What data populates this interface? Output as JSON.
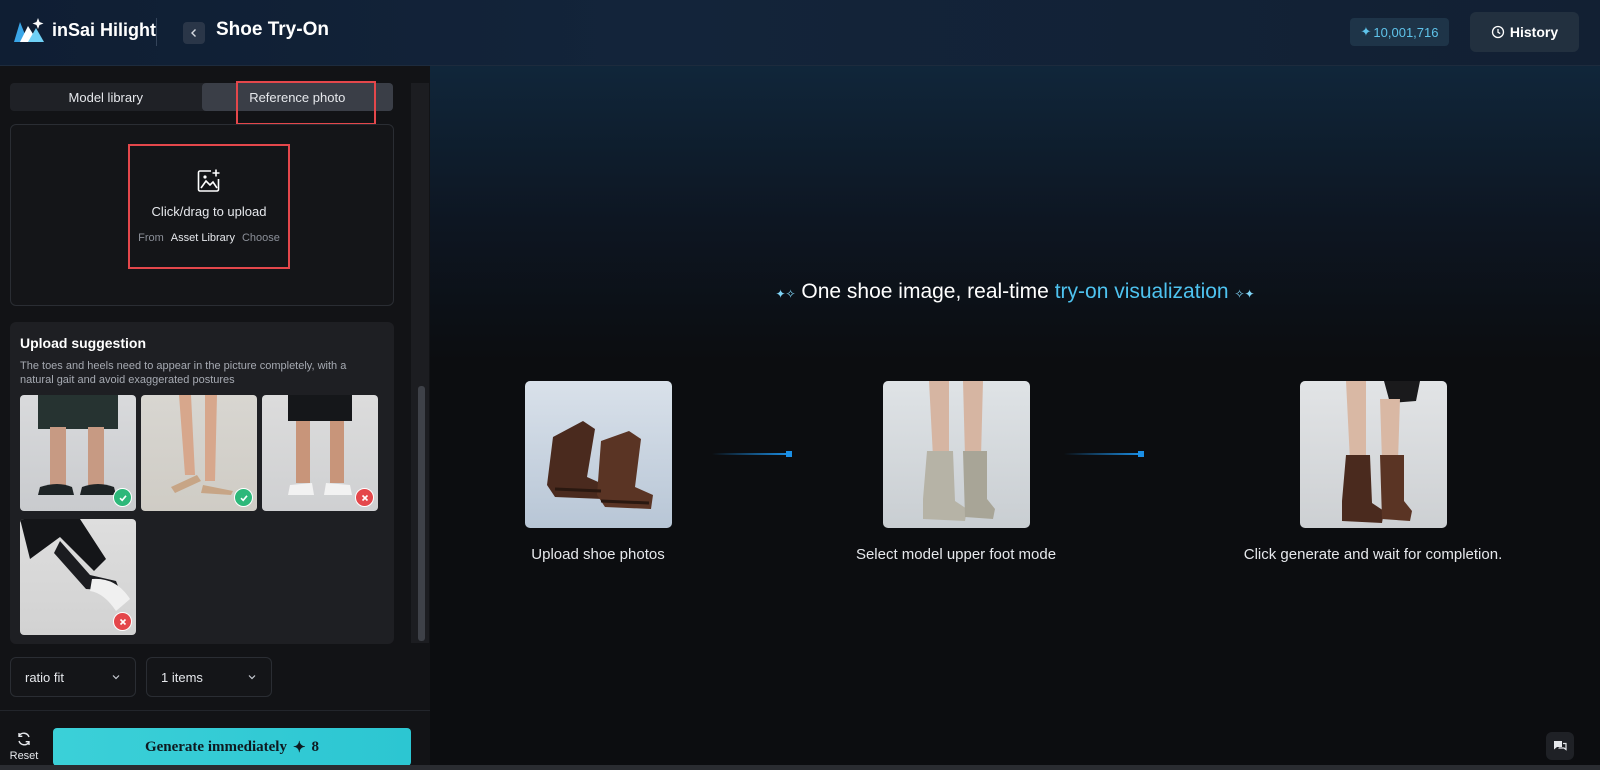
{
  "header": {
    "logo_text": "inSai Hilight",
    "title": "Shoe Try-On",
    "credits": "10,001,716",
    "history_label": "History"
  },
  "sidebar": {
    "tabs": [
      {
        "label": "Model library",
        "active": false
      },
      {
        "label": "Reference photo",
        "active": true
      }
    ],
    "upload": {
      "title": "Click/drag to upload",
      "from": "From",
      "library": "Asset Library",
      "choose": "Choose"
    },
    "suggestion": {
      "title": "Upload suggestion",
      "description": "The toes and heels need to appear in the picture completely, with a natural gait and avoid exaggerated postures",
      "examples": [
        {
          "status": "ok"
        },
        {
          "status": "ok"
        },
        {
          "status": "bad"
        },
        {
          "status": "bad"
        }
      ]
    },
    "ratio_select": "ratio fit",
    "items_select": "1 items",
    "reset_label": "Reset",
    "generate_label": "Generate immediately",
    "generate_cost": "8"
  },
  "main": {
    "headline_prefix": "One shoe image, real-time ",
    "headline_accent": "try-on visualization",
    "steps": [
      {
        "label": "Upload shoe photos"
      },
      {
        "label": "Select model upper foot mode"
      },
      {
        "label": "Click generate and wait for completion."
      }
    ]
  },
  "colors": {
    "accent": "#4ec3f0",
    "generate": "#2cc6d2",
    "highlight": "#e4474b",
    "ok": "#2eb87a"
  }
}
